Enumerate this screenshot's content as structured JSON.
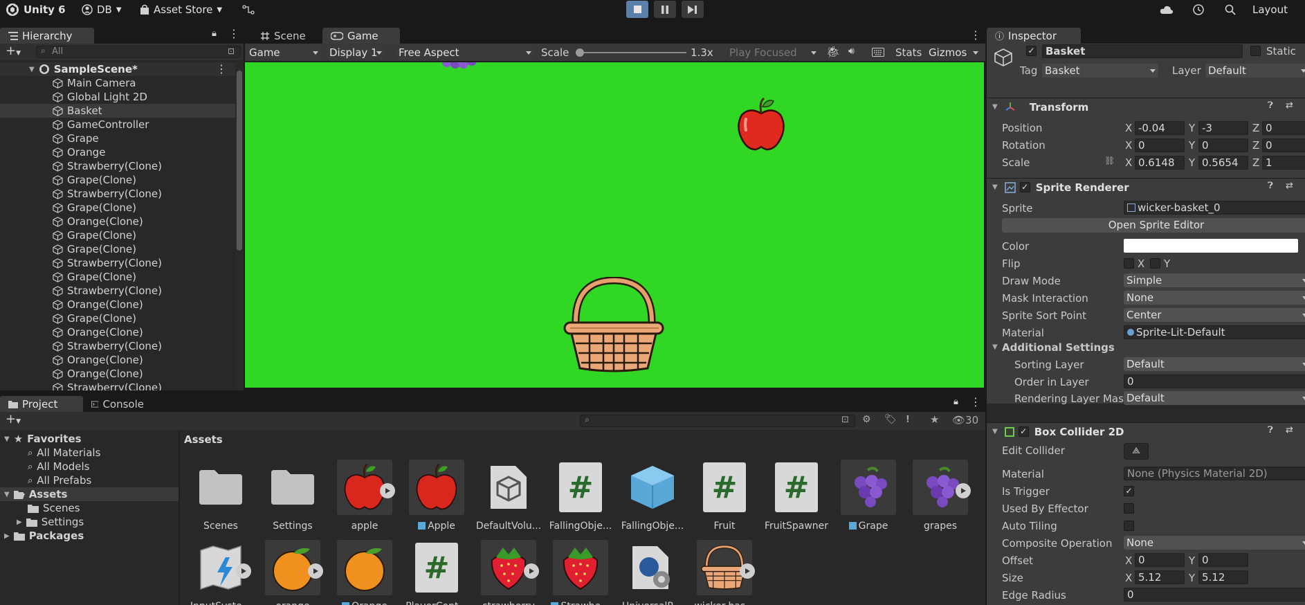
{
  "topbar": {
    "app": "Unity 6",
    "account": "DB",
    "asset_store": "Asset Store",
    "layout": "Layout"
  },
  "hierarchy": {
    "tab": "Hierarchy",
    "search_placeholder": "All",
    "scene": "SampleScene*",
    "items": [
      "Main Camera",
      "Global Light 2D",
      "Basket",
      "GameController",
      "Grape",
      "Orange",
      "Strawberry(Clone)",
      "Grape(Clone)",
      "Strawberry(Clone)",
      "Grape(Clone)",
      "Orange(Clone)",
      "Grape(Clone)",
      "Grape(Clone)",
      "Strawberry(Clone)",
      "Grape(Clone)",
      "Strawberry(Clone)",
      "Orange(Clone)",
      "Grape(Clone)",
      "Orange(Clone)",
      "Strawberry(Clone)",
      "Orange(Clone)",
      "Orange(Clone)",
      "Strawberry(Clone)"
    ]
  },
  "view_tabs": {
    "scene": "Scene",
    "game": "Game"
  },
  "game_toolbar": {
    "mode": "Game",
    "display": "Display 1",
    "aspect": "Free Aspect",
    "scale_label": "Scale",
    "scale_value": "1.3x",
    "play_mode": "Play Focused",
    "stats": "Stats",
    "gizmos": "Gizmos"
  },
  "game_view": {
    "background": "#31d725"
  },
  "inspector": {
    "tab": "Inspector",
    "object_name": "Basket",
    "static_label": "Static",
    "tag_label": "Tag",
    "tag_value": "Basket",
    "layer_label": "Layer",
    "layer_value": "Default",
    "transform": {
      "title": "Transform",
      "position_label": "Position",
      "position": {
        "x": "-0.04",
        "y": "-3",
        "z": "0"
      },
      "rotation_label": "Rotation",
      "rotation": {
        "x": "0",
        "y": "0",
        "z": "0"
      },
      "scale_label": "Scale",
      "scale": {
        "x": "0.6148",
        "y": "0.5654",
        "z": "1"
      }
    },
    "sprite_renderer": {
      "title": "Sprite Renderer",
      "sprite_label": "Sprite",
      "sprite_value": "wicker-basket_0",
      "open_editor": "Open Sprite Editor",
      "color_label": "Color",
      "flip_label": "Flip",
      "flip_x": "X",
      "flip_y": "Y",
      "draw_mode_label": "Draw Mode",
      "draw_mode": "Simple",
      "mask_label": "Mask Interaction",
      "mask": "None",
      "sort_point_label": "Sprite Sort Point",
      "sort_point": "Center",
      "material_label": "Material",
      "material": "Sprite-Lit-Default",
      "additional": "Additional Settings",
      "sorting_layer_label": "Sorting Layer",
      "sorting_layer": "Default",
      "order_label": "Order in Layer",
      "order": "0",
      "rendering_mask_label": "Rendering Layer Masl",
      "rendering_mask": "Default"
    },
    "box_collider": {
      "title": "Box Collider 2D",
      "edit_label": "Edit Collider",
      "material_label": "Material",
      "material": "None (Physics Material 2D)",
      "trigger_label": "Is Trigger",
      "effector_label": "Used By Effector",
      "tiling_label": "Auto Tiling",
      "composite_label": "Composite Operation",
      "composite": "None",
      "offset_label": "Offset",
      "offset": {
        "x": "0",
        "y": "0"
      },
      "size_label": "Size",
      "size": {
        "x": "5.12",
        "y": "5.12"
      },
      "edge_label": "Edge Radius",
      "edge": "0"
    }
  },
  "project": {
    "tab_project": "Project",
    "tab_console": "Console",
    "hidden_count": "30",
    "favorites": "Favorites",
    "fav_items": [
      "All Materials",
      "All Models",
      "All Prefabs"
    ],
    "assets": "Assets",
    "asset_folders": [
      "Scenes",
      "Settings"
    ],
    "packages": "Packages",
    "breadcrumb": "Assets",
    "grid": [
      "Scenes",
      "Settings",
      "apple",
      "Apple",
      "DefaultVolu...",
      "FallingObje...",
      "FallingObje...",
      "Fruit",
      "FruitSpawner",
      "Grape",
      "grapes",
      "InputSyste...",
      "orange",
      "Orange",
      "PlayerCont...",
      "strawberry",
      "Strawbe...",
      "UniversalR...",
      "wicker-bas..."
    ]
  }
}
